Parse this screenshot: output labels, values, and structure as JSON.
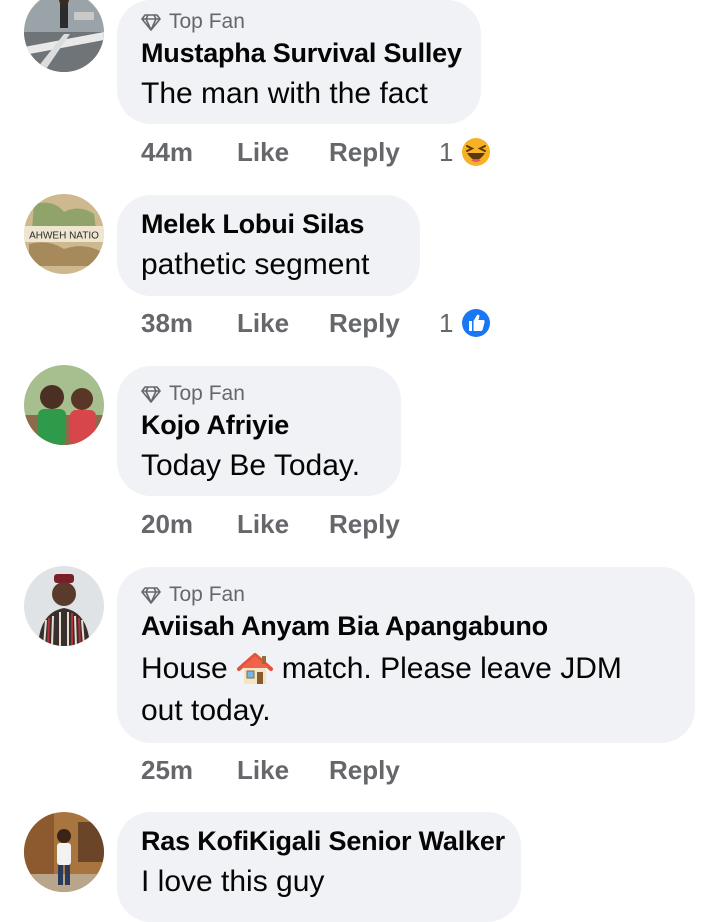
{
  "comments": [
    {
      "avatar_icon": "person-street-photo",
      "badge": "Top Fan",
      "name": "Mustapha Survival Sulley",
      "text": "The man with the fact",
      "time": "44m",
      "like": "Like",
      "reply": "Reply",
      "reaction_count": "1",
      "reaction_icon": "haha-emoji-icon"
    },
    {
      "avatar_icon": "map-banner-avatar",
      "avatar_text": "AHWEH NATIO",
      "name": "Melek Lobui Silas",
      "text": "pathetic segment",
      "time": "38m",
      "like": "Like",
      "reply": "Reply",
      "reaction_count": "1",
      "reaction_icon": "thumbs-up-icon"
    },
    {
      "avatar_icon": "two-kids-photo",
      "badge": "Top Fan",
      "name": "Kojo Afriyie",
      "text": "Today Be Today.",
      "time": "20m",
      "like": "Like",
      "reply": "Reply"
    },
    {
      "avatar_icon": "person-traditional-smock-photo",
      "badge": "Top Fan",
      "name": "Aviisah Anyam Bia Apangabuno",
      "text_line1_a": "House",
      "text_emoji": "house-emoji",
      "text_line1_b": "match. Please leave JDM",
      "text_line2": "out today.",
      "time": "25m",
      "like": "Like",
      "reply": "Reply"
    },
    {
      "avatar_icon": "person-standing-photo",
      "name": "Ras KofiKigali Senior Walker",
      "text": "I love this guy"
    }
  ],
  "colors": {
    "bubble": "#f0f2f5",
    "secondary_text": "#65676b",
    "primary_text": "#050505",
    "like_blue": "#1877f2",
    "haha_yellow": "#f7b125"
  }
}
